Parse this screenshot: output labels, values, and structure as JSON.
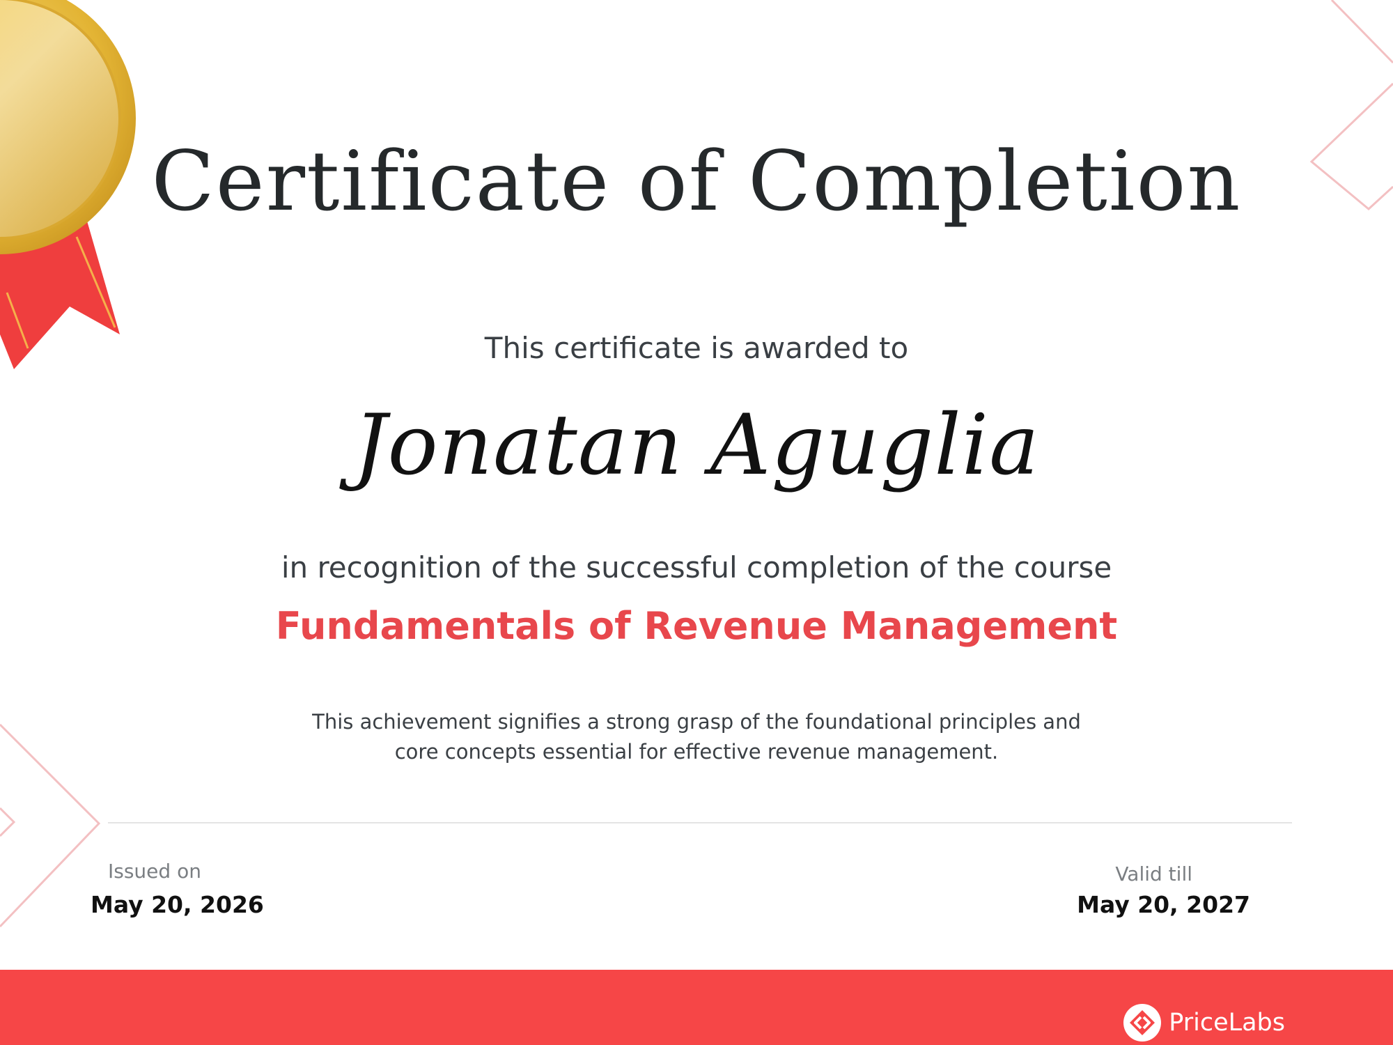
{
  "certificate": {
    "title": "Certificate of Completion",
    "awarded_text": "This certificate is awarded to",
    "recipient_name": "Jonatan Aguglia",
    "recognition_text": "in recognition of the successful completion of the course",
    "course_name": "Fundamentals of Revenue Management",
    "description_line1": "This achievement signifies a strong grasp of the foundational principles and",
    "description_line2": "core concepts essential for effective revenue management."
  },
  "dates": {
    "issued_label": "Issued on",
    "issued_value": "May 20, 2026",
    "valid_label": "Valid till",
    "valid_value": "May 20, 2027"
  },
  "footer": {
    "brand_name": "PriceLabs",
    "brand_icon": "pricelabs-logo-icon",
    "background_color": "#f64647"
  },
  "decorations": {
    "medal_icon": "gold-medal-icon",
    "accent_color": "#e8474c",
    "medal_color": "#e9b93a"
  }
}
